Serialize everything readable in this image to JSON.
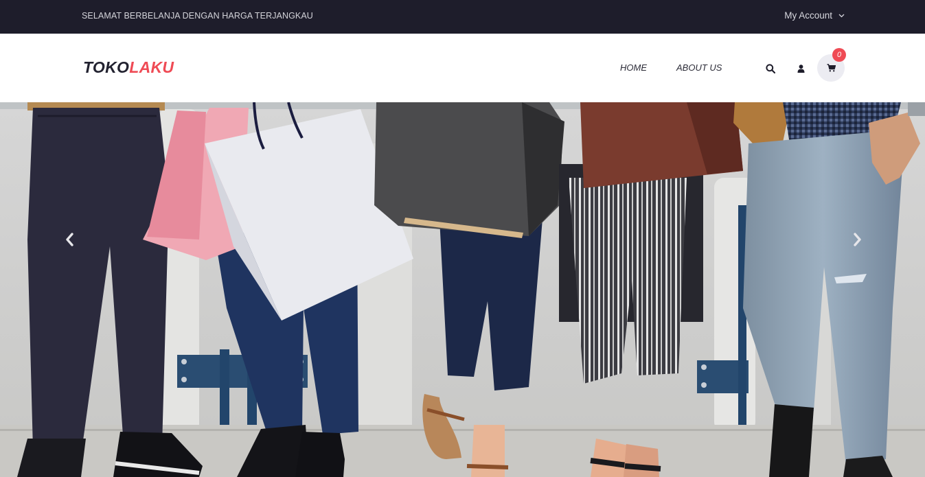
{
  "topbar": {
    "promo_text": "SELAMAT BERBELANJA DENGAN HARGA TERJANGKAU",
    "account_label": "My Account",
    "account_icon": "chevron-down-icon"
  },
  "header": {
    "logo_part1": "TOKO",
    "logo_part2": "LAKU",
    "nav": [
      {
        "label": "HOME"
      },
      {
        "label": "ABOUT US"
      }
    ],
    "icons": [
      "search-icon",
      "user-icon",
      "cart-icon"
    ],
    "cart_count": "0"
  },
  "hero": {
    "image": "shopping-bags-photo",
    "prev_icon": "chevron-left-icon",
    "next_icon": "chevron-right-icon"
  },
  "colors": {
    "topbar_bg": "#1e1d2b",
    "accent": "#ef4b55",
    "text_dark": "#222230",
    "cart_bg": "#ececf2"
  }
}
